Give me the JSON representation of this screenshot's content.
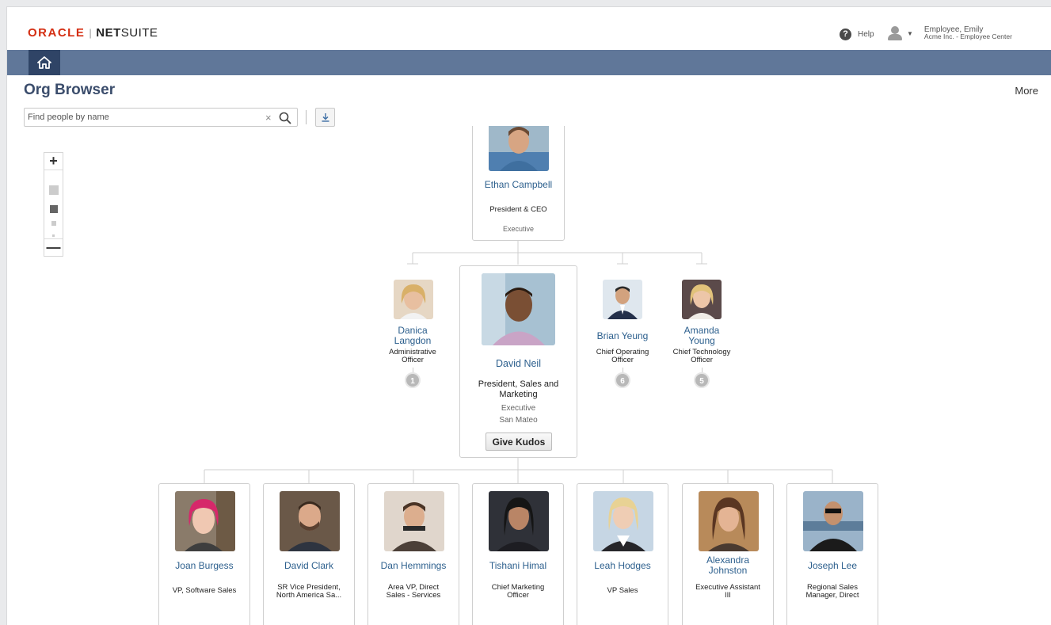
{
  "header": {
    "logo_oracle": "ORACLE",
    "logo_net": "NET",
    "logo_suite": "SUITE",
    "help_label": "Help",
    "user_name": "Employee, Emily",
    "user_org": "Acme Inc. - Employee Center"
  },
  "page": {
    "title": "Org Browser",
    "more_label": "More"
  },
  "search": {
    "placeholder": "Find people by name",
    "value": ""
  },
  "org": {
    "root": {
      "name": "Ethan Campbell",
      "title": "President & CEO",
      "dept": "Executive"
    },
    "peers": [
      {
        "name_line1": "Danica",
        "name_line2": "Langdon",
        "title_line1": "Administrative",
        "title_line2": "Officer",
        "reports": "1"
      },
      {
        "name_line1": "Brian Yeung",
        "name_line2": "",
        "title_line1": "Chief Operating",
        "title_line2": "Officer",
        "reports": "6"
      },
      {
        "name_line1": "Amanda",
        "name_line2": "Young",
        "title_line1": "Chief Technology",
        "title_line2": "Officer",
        "reports": "5"
      }
    ],
    "selected": {
      "name": "David Neil",
      "title_line1": "President, Sales and",
      "title_line2": "Marketing",
      "dept": "Executive",
      "location": "San Mateo",
      "kudos_label": "Give Kudos"
    },
    "reports": [
      {
        "name_line1": "Joan Burgess",
        "name_line2": "",
        "title_line1": "VP, Software Sales",
        "title_line2": ""
      },
      {
        "name_line1": "David Clark",
        "name_line2": "",
        "title_line1": "SR Vice President,",
        "title_line2": "North America Sa..."
      },
      {
        "name_line1": "Dan Hemmings",
        "name_line2": "",
        "title_line1": "Area VP, Direct",
        "title_line2": "Sales - Services"
      },
      {
        "name_line1": "Tishani Himal",
        "name_line2": "",
        "title_line1": "Chief Marketing",
        "title_line2": "Officer"
      },
      {
        "name_line1": "Leah Hodges",
        "name_line2": "",
        "title_line1": "VP Sales",
        "title_line2": ""
      },
      {
        "name_line1": "Alexandra",
        "name_line2": "Johnston",
        "title_line1": "Executive Assistant",
        "title_line2": "III"
      },
      {
        "name_line1": "Joseph Lee",
        "name_line2": "",
        "title_line1": "Regional Sales",
        "title_line2": "Manager, Direct"
      }
    ]
  },
  "colors": {
    "navbar": "#607799",
    "home_button": "#2f4466",
    "name_link": "#2c5f8d",
    "oracle_red": "#d42e12",
    "page_title": "#3b4d6c"
  },
  "icons": [
    "help-icon",
    "user-icon",
    "home-icon",
    "clear-icon",
    "search-icon",
    "download-icon",
    "zoom-in-icon",
    "zoom-out-icon"
  ]
}
